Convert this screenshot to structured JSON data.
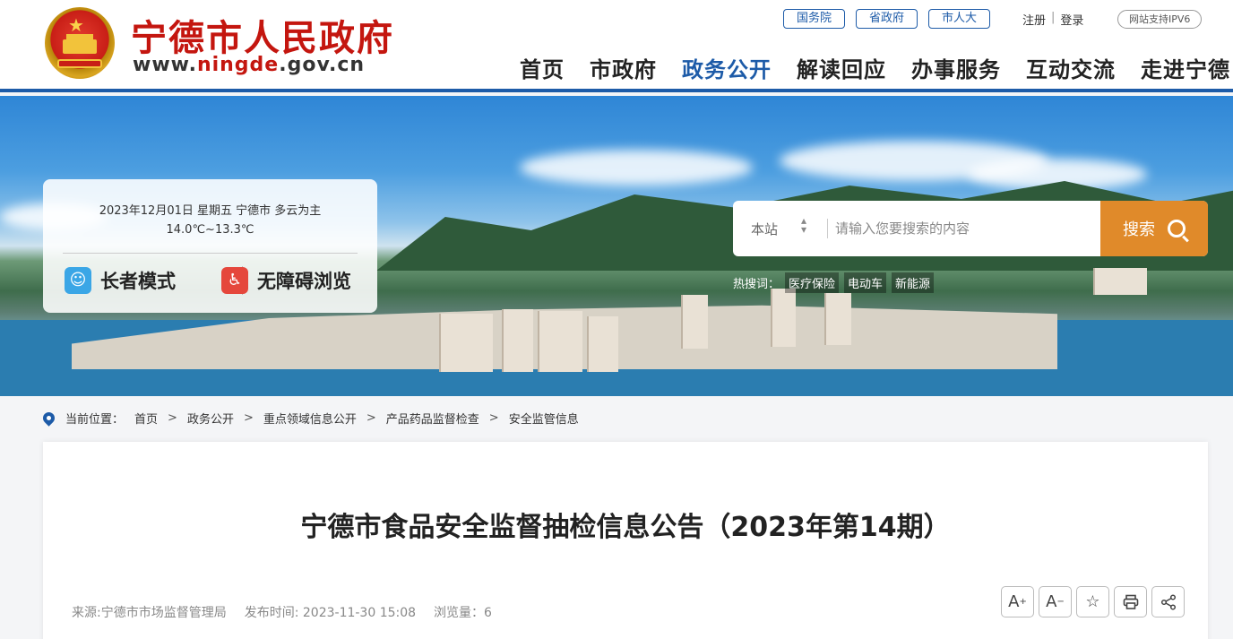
{
  "header": {
    "site_title": "宁德市人民政府",
    "url_prefix": "www.",
    "url_highlight": "ningde",
    "url_suffix": ".gov.cn",
    "top_links": [
      "国务院",
      "省政府",
      "市人大"
    ],
    "register": "注册",
    "login": "登录",
    "ipv6": "网站支持IPV6",
    "nav": [
      "首页",
      "市政府",
      "政务公开",
      "解读回应",
      "办事服务",
      "互动交流",
      "走进宁德"
    ],
    "active_nav": "政务公开"
  },
  "info_card": {
    "date_weather": "2023年12月01日 星期五  宁德市 多云为主",
    "temperature": "14.0℃~13.3℃",
    "elder_mode": "长者模式",
    "accessible": "无障碍浏览"
  },
  "search": {
    "scope": "本站",
    "placeholder": "请输入您要搜索的内容",
    "button": "搜索",
    "hot_label": "热搜词：",
    "hot_words": [
      "医疗保险",
      "电动车",
      "新能源"
    ]
  },
  "breadcrumb": {
    "label": "当前位置：",
    "items": [
      "首页",
      "政务公开",
      "重点领域信息公开",
      "产品药品监督检查",
      "安全监管信息"
    ],
    "separator": ">"
  },
  "article": {
    "title": "宁德市食品安全监督抽检信息公告（2023年第14期）",
    "source": "来源:宁德市市场监督管理局",
    "publish_time": "发布时间: 2023-11-30 15:08",
    "views": "浏览量：6",
    "tools": {
      "font_up": "A",
      "font_up_sup": "+",
      "font_down": "A",
      "font_down_sup": "−"
    }
  },
  "colors": {
    "brand_red": "#c4160f",
    "brand_blue": "#1d5ba8",
    "search_orange": "#e08a2a"
  }
}
